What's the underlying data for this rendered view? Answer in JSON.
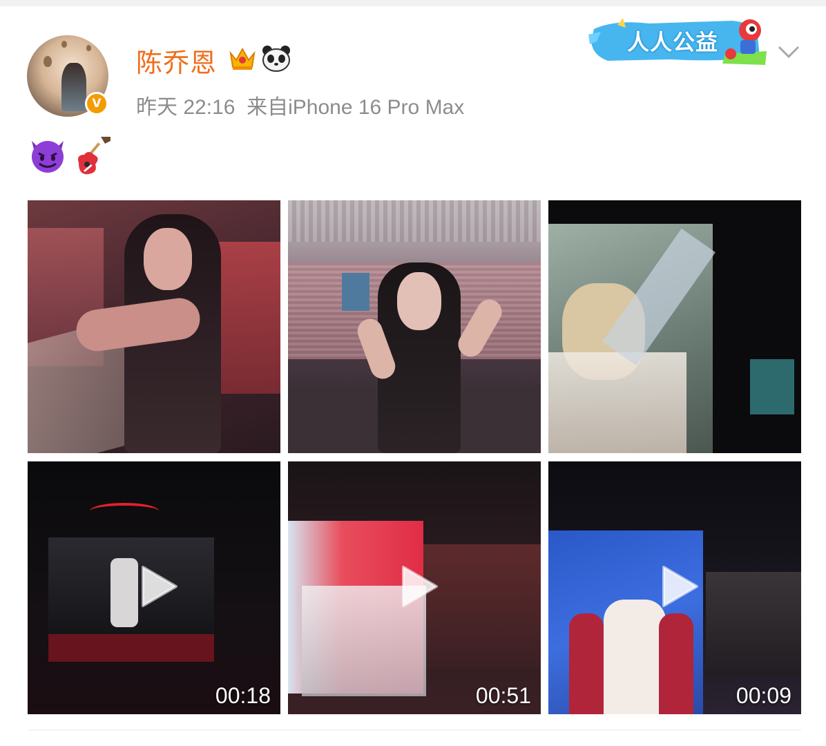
{
  "user": {
    "name": "陈乔恩",
    "verified_glyph": "V",
    "timestamp": "昨天 22:16",
    "source": "来自iPhone 16 Pro Max"
  },
  "promo": {
    "label": "人人公益"
  },
  "post": {
    "emojis": [
      "😈",
      "🎸"
    ]
  },
  "media": [
    {
      "type": "photo",
      "description_icon": "photo-1"
    },
    {
      "type": "photo",
      "description_icon": "photo-2"
    },
    {
      "type": "photo",
      "description_icon": "photo-3"
    },
    {
      "type": "video",
      "duration": "00:18"
    },
    {
      "type": "video",
      "duration": "00:51"
    },
    {
      "type": "video",
      "duration": "00:09"
    }
  ],
  "colors": {
    "username": "#f06e1d",
    "meta": "#8c8c8c",
    "verified": "#f59b00"
  }
}
